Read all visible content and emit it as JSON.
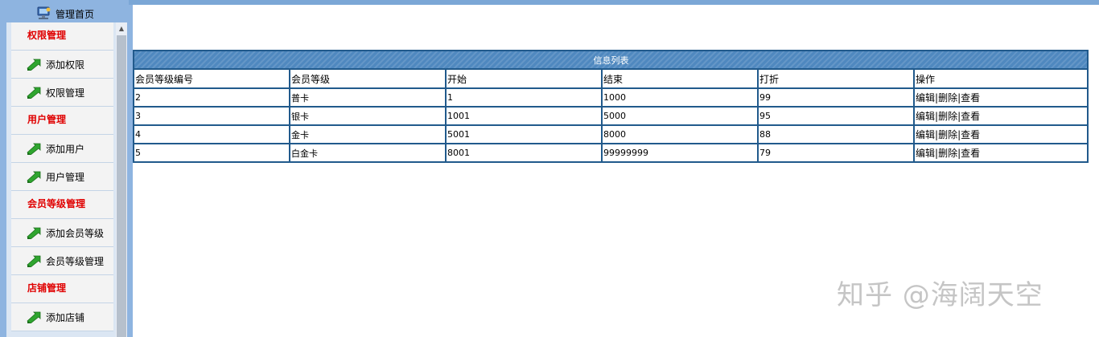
{
  "sidebar": {
    "home_label": "管理首页",
    "sections": [
      {
        "title": "权限管理",
        "items": [
          "添加权限",
          "权限管理"
        ]
      },
      {
        "title": "用户管理",
        "items": [
          "添加用户",
          "用户管理"
        ]
      },
      {
        "title": "会员等级管理",
        "items": [
          "添加会员等级",
          "会员等级管理"
        ]
      },
      {
        "title": "店铺管理",
        "items": [
          "添加店铺"
        ]
      }
    ]
  },
  "table": {
    "title": "信息列表",
    "columns": [
      "会员等级编号",
      "会员等级",
      "开始",
      "结束",
      "打折",
      "操作"
    ],
    "rows": [
      [
        "2",
        "普卡",
        "1",
        "1000",
        "99"
      ],
      [
        "3",
        "银卡",
        "1001",
        "5000",
        "95"
      ],
      [
        "4",
        "金卡",
        "5001",
        "8000",
        "88"
      ],
      [
        "5",
        "白金卡",
        "8001",
        "99999999",
        "79"
      ]
    ],
    "actions": [
      "编辑",
      "删除",
      "查看"
    ],
    "separator": "|"
  },
  "watermark": "知乎 @海阔天空",
  "colors": {
    "frame": "#8eb4e0",
    "table_border": "#215a8c",
    "title_bar": "#4f88bf",
    "section_title": "#e00000",
    "menu_bg": "#f3f3f3"
  },
  "icons": {
    "home": "home-computer-icon",
    "menu_item": "green-arrow-icon"
  }
}
